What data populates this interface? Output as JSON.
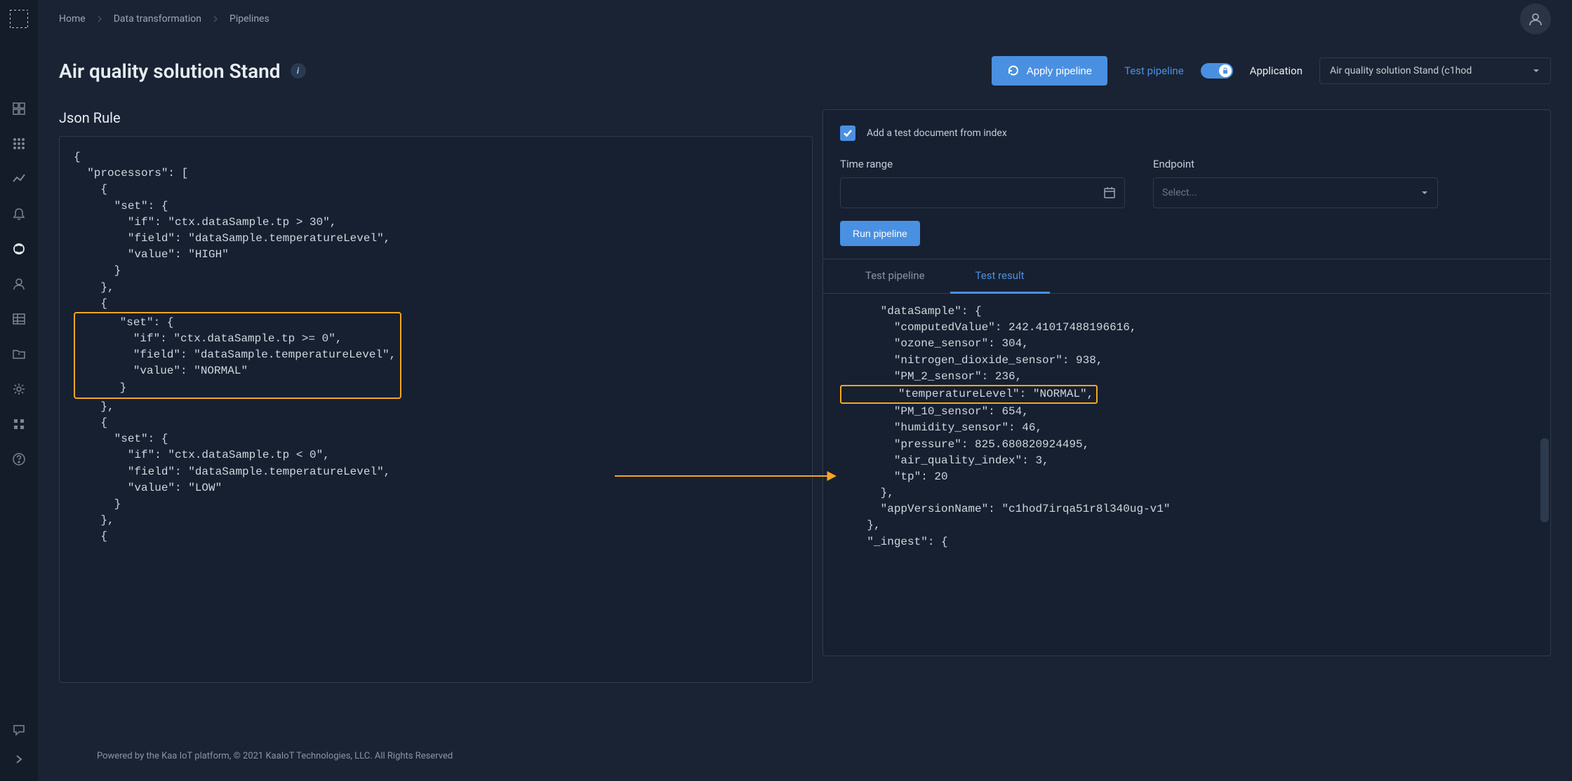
{
  "breadcrumbs": [
    "Home",
    "Data transformation",
    "Pipelines"
  ],
  "page_title": "Air quality solution Stand",
  "apply_button": "Apply pipeline",
  "test_pipeline_link": "Test pipeline",
  "app_label": "Application",
  "app_select_value": "Air quality solution Stand (c1hod",
  "json_rule_label": "Json Rule",
  "json_rule_code": "{\n  \"processors\": [\n    {\n      \"set\": {\n        \"if\": \"ctx.dataSample.tp > 30\",\n        \"field\": \"dataSample.temperatureLevel\",\n        \"value\": \"HIGH\"\n      }\n    },\n    {",
  "json_rule_highlight": "      \"set\": {\n        \"if\": \"ctx.dataSample.tp >= 0\",\n        \"field\": \"dataSample.temperatureLevel\",\n        \"value\": \"NORMAL\"\n      }",
  "json_rule_code2": "    },\n    {\n      \"set\": {\n        \"if\": \"ctx.dataSample.tp < 0\",\n        \"field\": \"dataSample.temperatureLevel\",\n        \"value\": \"LOW\"\n      }\n    },\n    {",
  "right_panel": {
    "checkbox_label": "Add a test document from index",
    "time_range_label": "Time range",
    "endpoint_label": "Endpoint",
    "endpoint_placeholder": "Select...",
    "run_button": "Run pipeline",
    "tabs": [
      "Test pipeline",
      "Test result"
    ],
    "result_pre": "      \"dataSample\": {\n        \"computedValue\": 242.41017488196616,\n        \"ozone_sensor\": 304,\n        \"nitrogen_dioxide_sensor\": 938,\n        \"PM_2_sensor\": 236,",
    "result_highlight": "        \"temperatureLevel\": \"NORMAL\",",
    "result_post": "        \"PM_10_sensor\": 654,\n        \"humidity_sensor\": 46,\n        \"pressure\": 825.680820924495,\n        \"air_quality_index\": 3,\n        \"tp\": 20\n      },\n      \"appVersionName\": \"c1hod7irqa51r8l340ug-v1\"\n    },\n    \"_ingest\": {"
  },
  "footer": "Powered by the Kaa IoT platform, © 2021 KaaIoT Technologies, LLC. All Rights Reserved",
  "colors": {
    "accent": "#4a90e2",
    "annotation": "#f5a623"
  }
}
